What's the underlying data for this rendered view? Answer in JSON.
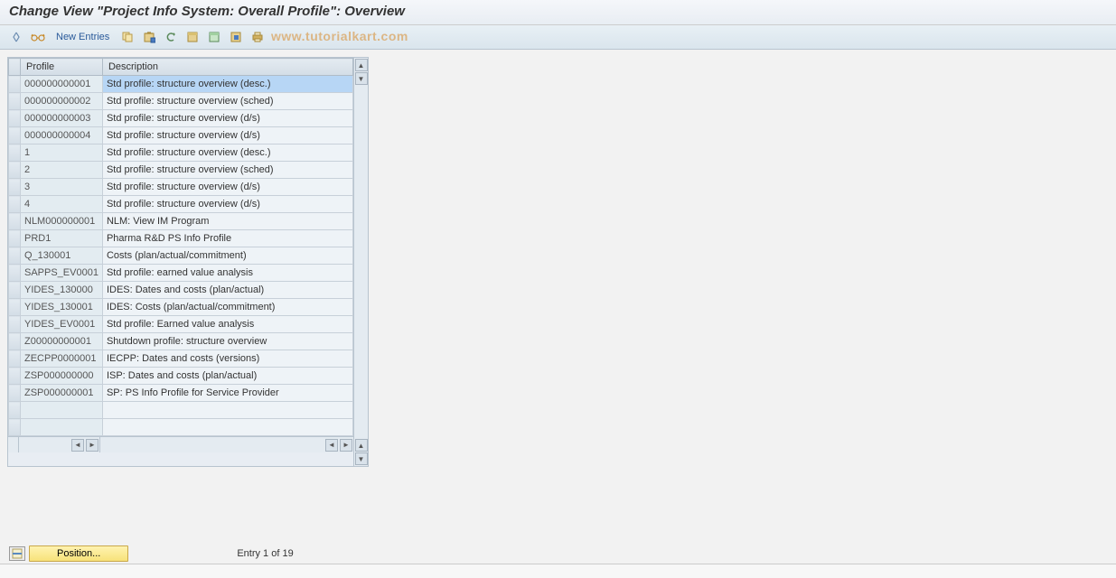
{
  "title": "Change View \"Project Info System: Overall Profile\": Overview",
  "toolbar": {
    "new_entries": "New Entries"
  },
  "watermark": "www.tutorialkart.com",
  "table": {
    "headers": {
      "profile": "Profile",
      "description": "Description"
    },
    "rows": [
      {
        "profile": "000000000001",
        "description": "Std profile: structure overview (desc.)",
        "selected": true
      },
      {
        "profile": "000000000002",
        "description": "Std profile: structure overview (sched)"
      },
      {
        "profile": "000000000003",
        "description": "Std profile: structure overview (d/s)"
      },
      {
        "profile": "000000000004",
        "description": "Std profile: structure overview (d/s)"
      },
      {
        "profile": "1",
        "description": "Std profile: structure overview (desc.)"
      },
      {
        "profile": "2",
        "description": "Std profile: structure overview (sched)"
      },
      {
        "profile": "3",
        "description": "Std profile: structure overview (d/s)"
      },
      {
        "profile": "4",
        "description": "Std profile: structure overview (d/s)"
      },
      {
        "profile": "NLM000000001",
        "description": "NLM: View IM Program"
      },
      {
        "profile": "PRD1",
        "description": "Pharma R&D PS Info Profile"
      },
      {
        "profile": "Q_130001",
        "description": "Costs (plan/actual/commitment)"
      },
      {
        "profile": "SAPPS_EV0001",
        "description": "Std profile: earned value analysis"
      },
      {
        "profile": "YIDES_130000",
        "description": "IDES: Dates and costs (plan/actual)"
      },
      {
        "profile": "YIDES_130001",
        "description": "IDES: Costs (plan/actual/commitment)"
      },
      {
        "profile": "YIDES_EV0001",
        "description": "Std profile: Earned value analysis"
      },
      {
        "profile": "Z00000000001",
        "description": "Shutdown profile: structure overview"
      },
      {
        "profile": "ZECPP0000001",
        "description": "IECPP: Dates and costs (versions)"
      },
      {
        "profile": "ZSP000000000",
        "description": "ISP: Dates and costs (plan/actual)"
      },
      {
        "profile": "ZSP000000001",
        "description": "SP: PS Info Profile for Service Provider"
      },
      {
        "profile": "",
        "description": ""
      },
      {
        "profile": "",
        "description": ""
      }
    ]
  },
  "footer": {
    "position_label": "Position...",
    "entry_text": "Entry 1 of 19"
  }
}
